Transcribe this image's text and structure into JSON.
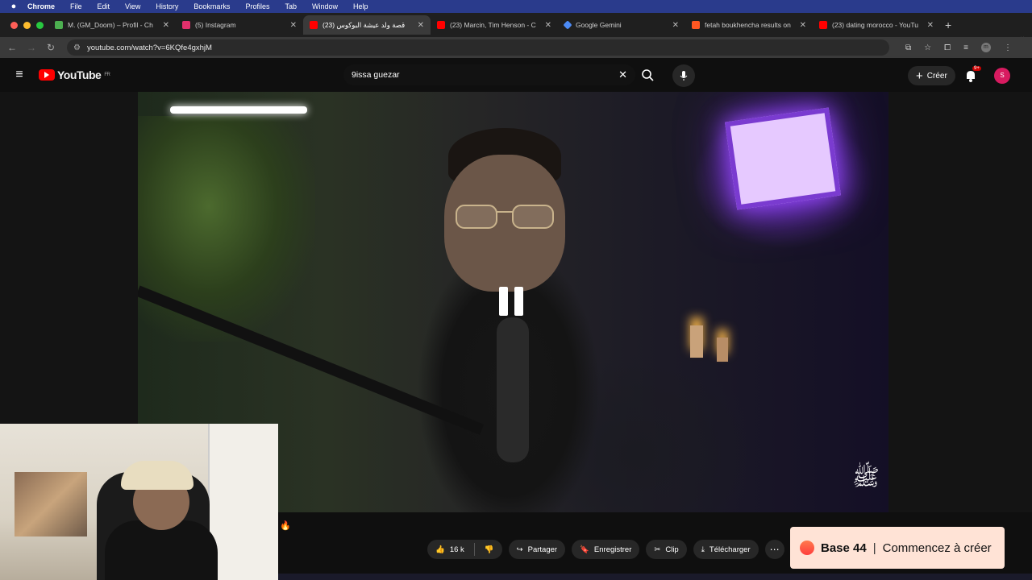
{
  "macos_menu": {
    "items": [
      "Chrome",
      "File",
      "Edit",
      "View",
      "History",
      "Bookmarks",
      "Profiles",
      "Tab",
      "Window",
      "Help"
    ]
  },
  "tabs": [
    {
      "title": "M. (GM_Doom) – Profil - Ch",
      "color": "#4caf50",
      "active": false
    },
    {
      "title": "(5) Instagram",
      "color": "#e1306c",
      "active": false
    },
    {
      "title": "(23) قصة ولد عيشة البوكوس",
      "color": "#ff0000",
      "active": true
    },
    {
      "title": "(23) Marcin, Tim Henson - C",
      "color": "#ff0000",
      "active": false
    },
    {
      "title": "Google Gemini",
      "color": "#4c8bf5",
      "active": false
    },
    {
      "title": "fetah boukhencha results on",
      "color": "#ff5722",
      "active": false
    },
    {
      "title": "(23) dating morocco - YouTu",
      "color": "#ff0000",
      "active": false
    }
  ],
  "browser": {
    "url": "youtube.com/watch?v=6KQfe4gxhjM"
  },
  "youtube": {
    "logo_text": "YouTube",
    "region": "FR",
    "search_value": "9issa guezar",
    "create_label": "Créer",
    "notifications_badge": "9+",
    "avatar_letter": "S"
  },
  "actions": {
    "likes": "16 k",
    "share": "Partager",
    "save": "Enregistrer",
    "clip": "Clip",
    "download": "Télécharger"
  },
  "ad": {
    "brand": "Base 44",
    "cta": "Commencez à créer"
  }
}
